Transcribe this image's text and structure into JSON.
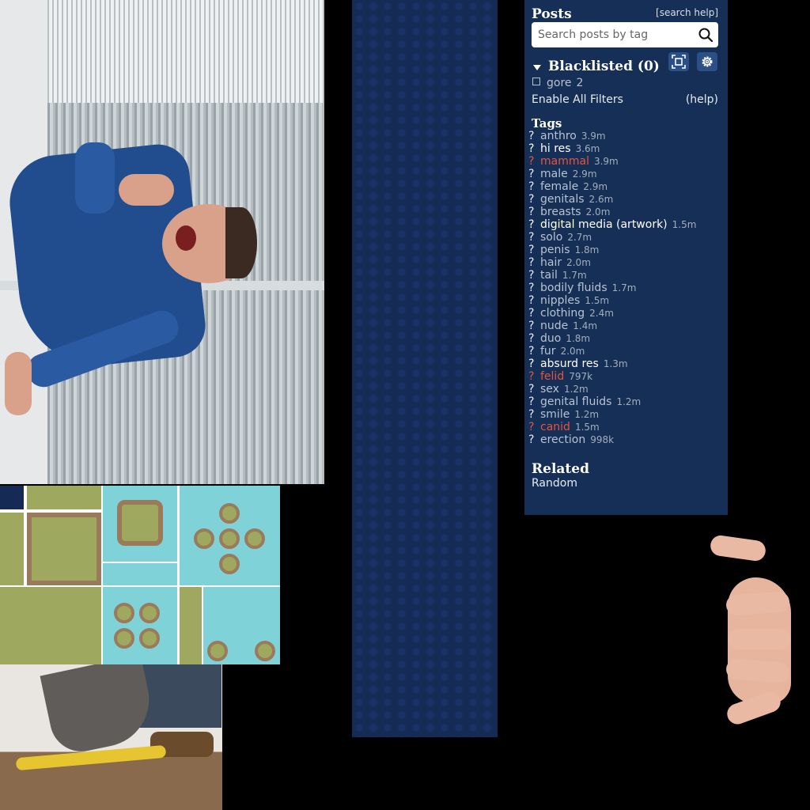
{
  "sidebar": {
    "posts_title": "Posts",
    "search_help": "[search help]",
    "search_placeholder": "Search posts by tag",
    "blacklisted_label": "Blacklisted (0)",
    "blacklist_items": [
      {
        "name": "gore",
        "count": "2"
      }
    ],
    "enable_filters": "Enable All Filters",
    "help_link": "(help)",
    "tags_title": "Tags",
    "tags": [
      {
        "q": "?",
        "name": "anthro",
        "count": "3.9m",
        "style": "normal"
      },
      {
        "q": "?",
        "name": "hi res",
        "count": "3.6m",
        "style": "bright"
      },
      {
        "q": "?",
        "name": "mammal",
        "count": "3.9m",
        "style": "red"
      },
      {
        "q": "?",
        "name": "male",
        "count": "2.9m",
        "style": "normal"
      },
      {
        "q": "?",
        "name": "female",
        "count": "2.9m",
        "style": "normal"
      },
      {
        "q": "?",
        "name": "genitals",
        "count": "2.6m",
        "style": "normal"
      },
      {
        "q": "?",
        "name": "breasts",
        "count": "2.0m",
        "style": "normal"
      },
      {
        "q": "?",
        "name": "digital media (artwork)",
        "count": "1.5m",
        "style": "bright"
      },
      {
        "q": "?",
        "name": "solo",
        "count": "2.7m",
        "style": "normal"
      },
      {
        "q": "?",
        "name": "penis",
        "count": "1.8m",
        "style": "normal"
      },
      {
        "q": "?",
        "name": "hair",
        "count": "2.0m",
        "style": "normal"
      },
      {
        "q": "?",
        "name": "tail",
        "count": "1.7m",
        "style": "normal"
      },
      {
        "q": "?",
        "name": "bodily fluids",
        "count": "1.7m",
        "style": "normal"
      },
      {
        "q": "?",
        "name": "nipples",
        "count": "1.5m",
        "style": "normal"
      },
      {
        "q": "?",
        "name": "clothing",
        "count": "2.4m",
        "style": "normal"
      },
      {
        "q": "?",
        "name": "nude",
        "count": "1.4m",
        "style": "normal"
      },
      {
        "q": "?",
        "name": "duo",
        "count": "1.8m",
        "style": "normal"
      },
      {
        "q": "?",
        "name": "fur",
        "count": "2.0m",
        "style": "normal"
      },
      {
        "q": "?",
        "name": "absurd res",
        "count": "1.3m",
        "style": "bright"
      },
      {
        "q": "?",
        "name": "felid",
        "count": "797k",
        "style": "red"
      },
      {
        "q": "?",
        "name": "sex",
        "count": "1.2m",
        "style": "normal"
      },
      {
        "q": "?",
        "name": "genital fluids",
        "count": "1.2m",
        "style": "normal"
      },
      {
        "q": "?",
        "name": "smile",
        "count": "1.2m",
        "style": "normal"
      },
      {
        "q": "?",
        "name": "canid",
        "count": "1.5m",
        "style": "red"
      },
      {
        "q": "?",
        "name": "erection",
        "count": "998k",
        "style": "normal"
      }
    ],
    "related_title": "Related",
    "random_link": "Random"
  },
  "icons": {
    "search": "search-icon",
    "fullscreen": "fullscreen-icon",
    "gear": "gear-icon",
    "collapse": "triangle-down-icon"
  },
  "colors": {
    "sidebar_bg": "#152f56",
    "tag_red": "#e4553e",
    "button_bg": "#2c4f86"
  }
}
